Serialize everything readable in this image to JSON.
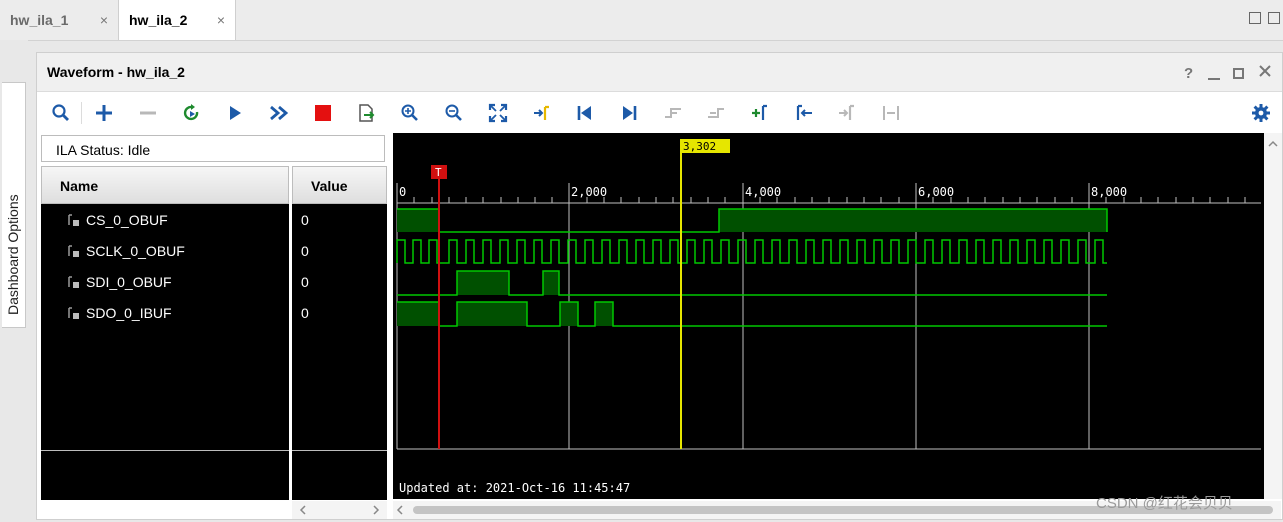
{
  "tabs": [
    {
      "label": "hw_ila_1",
      "active": false
    },
    {
      "label": "hw_ila_2",
      "active": true
    }
  ],
  "tab_close_glyph": "×",
  "side_panel": {
    "label": "Dashboard Options"
  },
  "waveform": {
    "title": "Waveform - hw_ila_2",
    "help_glyph": "?",
    "status": "ILA Status:  Idle",
    "columns": {
      "name": "Name",
      "value": "Value"
    },
    "signals": [
      {
        "name": "CS_0_OBUF",
        "value": "0"
      },
      {
        "name": "SCLK_0_OBUF",
        "value": "0"
      },
      {
        "name": "SDI_0_OBUF",
        "value": "0"
      },
      {
        "name": "SDO_0_IBUF",
        "value": "0"
      }
    ],
    "time_ticks": [
      "0",
      "2,000",
      "4,000",
      "6,000",
      "8,000"
    ],
    "cursor_label": "3,302",
    "trigger_label": "T",
    "updated": "Updated at: 2021-Oct-16 11:45:47"
  },
  "toolbar_icons": [
    "search-icon",
    "add-icon",
    "remove-icon",
    "refresh-icon",
    "run-icon",
    "run-all-icon",
    "stop-icon",
    "export-icon",
    "zoom-in-icon",
    "zoom-out-icon",
    "zoom-fit-icon",
    "go-to-cursor-icon",
    "go-to-start-icon",
    "go-to-end-icon",
    "prev-transition-icon",
    "next-transition-icon",
    "add-marker-icon",
    "prev-marker-icon",
    "next-marker-icon",
    "swap-cursors-icon",
    "settings-icon"
  ],
  "colors": {
    "wave": "#00c800",
    "wave_fill": "#005000",
    "grid": "#bfbfbf",
    "cursor": "#e6e600",
    "trigger": "#d01010",
    "accent": "#1d5aa8"
  },
  "watermark": "CSDN @红花会贝贝"
}
